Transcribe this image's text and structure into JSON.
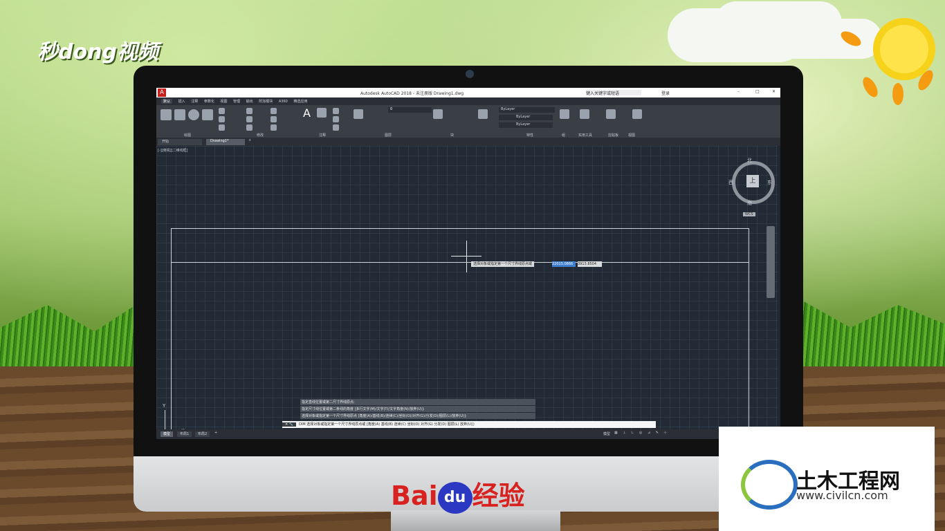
{
  "window": {
    "title": "Autodesk AutoCAD 2018 - 未注册版    Drawing1.dwg",
    "search_placeholder": "键入关键字或短语",
    "user": "登录"
  },
  "ribbon": {
    "tabs": [
      "默认",
      "插入",
      "注释",
      "参数化",
      "视图",
      "管理",
      "输出",
      "附加模块",
      "A360",
      "精选应用"
    ],
    "panels": [
      "绘图",
      "修改",
      "注释",
      "图层",
      "块",
      "特性",
      "组",
      "实用工具",
      "剪贴板",
      "视图"
    ],
    "layer_value": "0",
    "bylayer": "ByLayer"
  },
  "doc_tabs": [
    "开始",
    "Drawing1*"
  ],
  "view_label": "[-][俯视][二维线框]",
  "viewcube": {
    "north": "北",
    "south": "南",
    "east": "东",
    "west": "西",
    "top": "上",
    "wcs": "WCS"
  },
  "prompt": {
    "text": "选择对象或指定第一个尺寸界线原点或",
    "input1": "22015.0866",
    "input2": "3913.8504"
  },
  "command_history": [
    "指定直线位置或第二尺寸界线原点:",
    "指定尺寸线位置或第二条线的角度 [多行文字(M)/文字(T)/文字角度(N)/放弃(U)]:",
    "选择对象或指定第一个尺寸界线原点 [角度(A)/基线(B)/连续(C)/坐标(O)/对齐(G)/分发(D)/图层(L)/放弃(U)]:"
  ],
  "command_line": "DIM 选择对象或指定第一个尺寸界线原点或 [角度(A) 基线(B) 连续(C) 坐标(O) 对齐(G) 分发(D) 图层(L) 放弃(U)]:",
  "layout_tabs": [
    "模型",
    "布局1",
    "布局2"
  ],
  "status_model": "模型",
  "ucs": {
    "x": "X",
    "y": "Y"
  },
  "branding": {
    "top_left": "秒dong视频",
    "baidu_a": "Bai",
    "baidu_du": "du",
    "baidu_b": "经验",
    "civil_name": "土木工程网",
    "civil_url": "www.civilcn.com"
  }
}
